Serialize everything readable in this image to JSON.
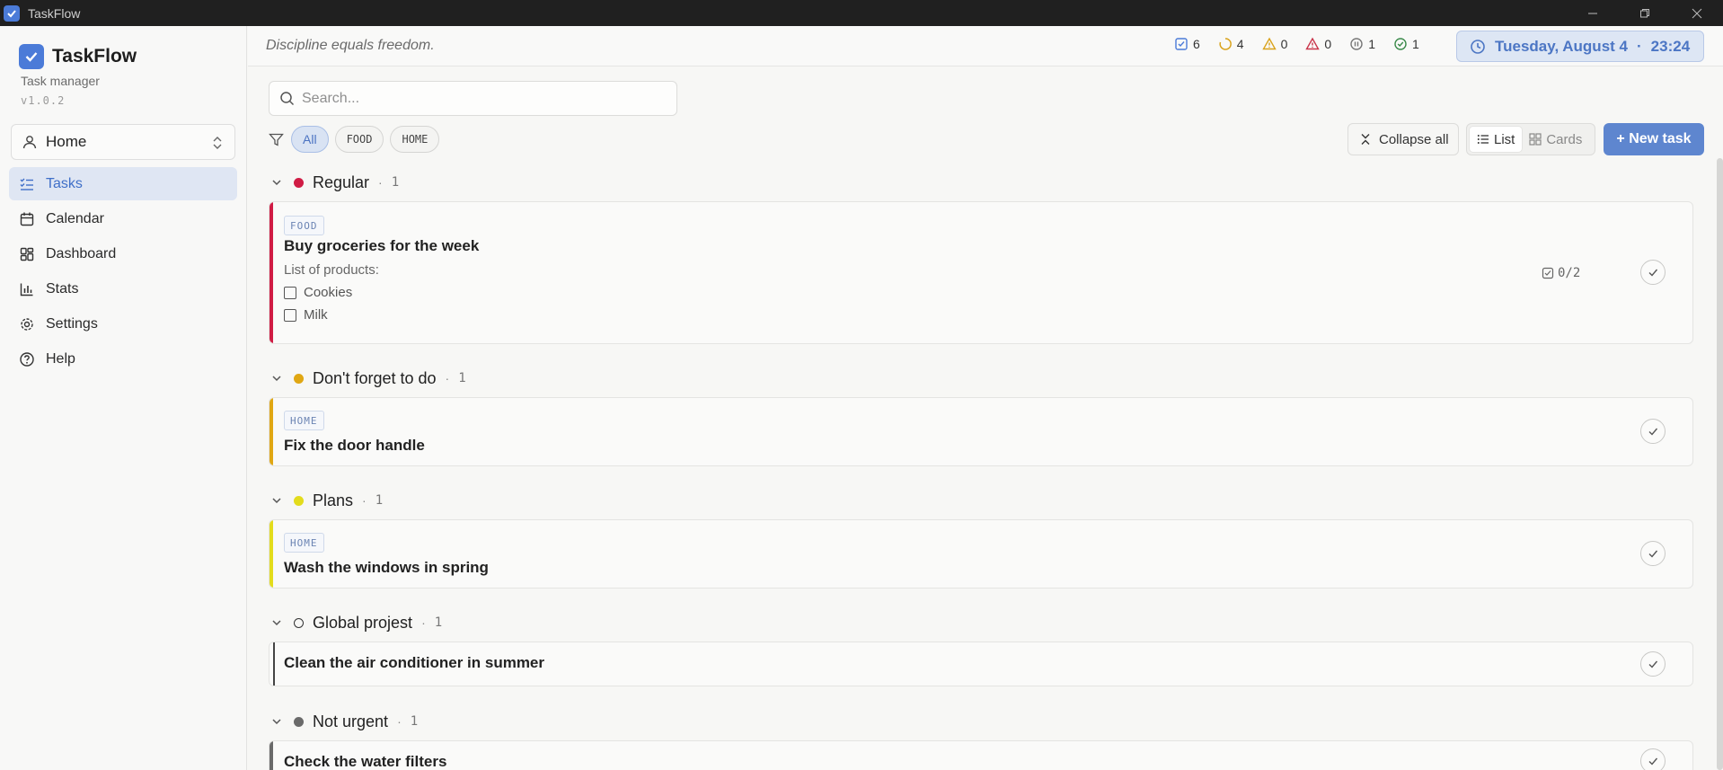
{
  "window": {
    "title": "TaskFlow"
  },
  "sidebar": {
    "brand_name": "TaskFlow",
    "brand_sub": "Task manager",
    "version": "v1.0.2",
    "workspace": "Home",
    "nav": [
      {
        "label": "Tasks",
        "icon": "tasks-icon",
        "active": true
      },
      {
        "label": "Calendar",
        "icon": "calendar-icon",
        "active": false
      },
      {
        "label": "Dashboard",
        "icon": "dashboard-icon",
        "active": false
      },
      {
        "label": "Stats",
        "icon": "stats-icon",
        "active": false
      },
      {
        "label": "Settings",
        "icon": "gear-icon",
        "active": false
      },
      {
        "label": "Help",
        "icon": "help-icon",
        "active": false
      }
    ]
  },
  "topbar": {
    "quote": "Discipline equals freedom.",
    "stats": [
      {
        "name": "total",
        "value": "6",
        "color": "#4b7bd8"
      },
      {
        "name": "in-progress",
        "value": "4",
        "color": "#d9a21b"
      },
      {
        "name": "warning",
        "value": "0",
        "color": "#d9a21b"
      },
      {
        "name": "overdue",
        "value": "0",
        "color": "#c9344a"
      },
      {
        "name": "paused",
        "value": "1",
        "color": "#777777"
      },
      {
        "name": "done",
        "value": "1",
        "color": "#3a8a4a"
      }
    ],
    "date": "Tuesday, August 4",
    "time": "23:24"
  },
  "toolbar": {
    "search_placeholder": "Search...",
    "filters": [
      "All",
      "FOOD",
      "HOME"
    ],
    "collapse_label": "Collapse all",
    "view_list": "List",
    "view_cards": "Cards",
    "new_task": "+ New task"
  },
  "groups": [
    {
      "name": "Regular",
      "count": "1",
      "color": "#d01c44"
    },
    {
      "name": "Don't forget to do",
      "count": "1",
      "color": "#e0a713"
    },
    {
      "name": "Plans",
      "count": "1",
      "color": "#e3dc1c"
    },
    {
      "name": "Global projest",
      "count": "1",
      "color": "none"
    },
    {
      "name": "Not urgent",
      "count": "1",
      "color": "#6a6a6a"
    }
  ],
  "tasks": [
    {
      "tag": "FOOD",
      "title": "Buy groceries for the week",
      "desc": "List of products:",
      "items": [
        "Cookies",
        "Milk"
      ],
      "subcount": "0/2"
    },
    {
      "tag": "HOME",
      "title": "Fix the door handle"
    },
    {
      "tag": "HOME",
      "title": "Wash the windows in spring"
    },
    {
      "title": "Clean the air conditioner in summer"
    },
    {
      "title": "Check the water filters"
    }
  ]
}
